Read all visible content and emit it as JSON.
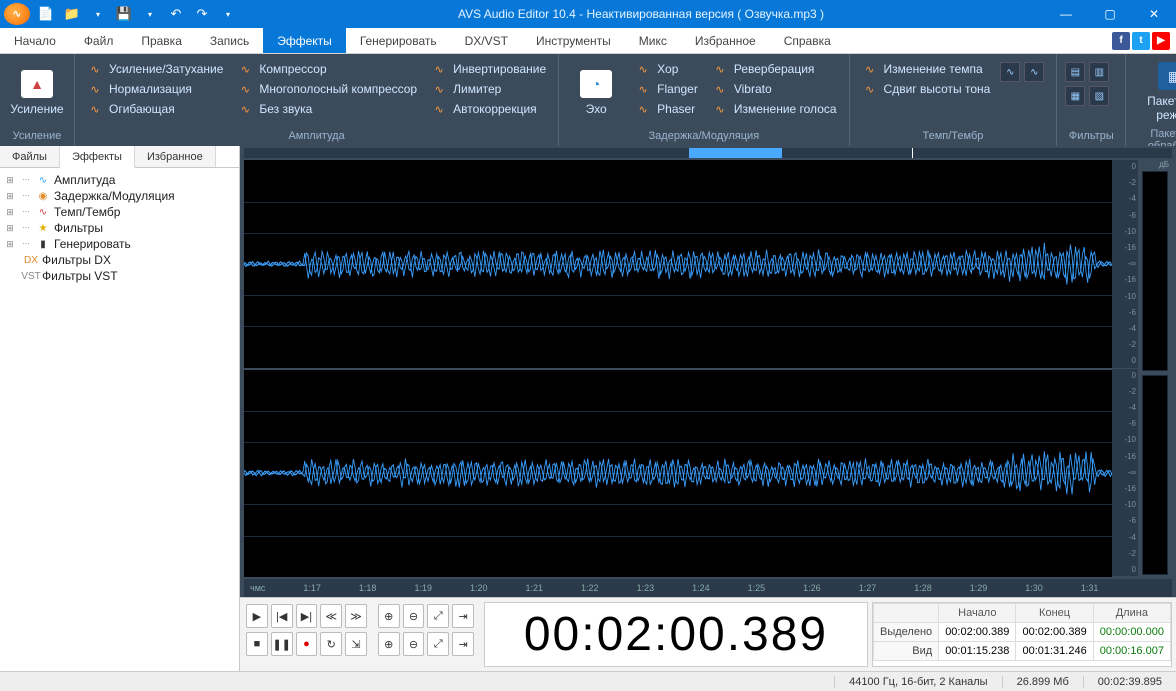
{
  "window": {
    "title": "AVS Audio Editor 10.4 - Неактивированная версия ( Озвучка.mp3 )"
  },
  "menus": [
    "Начало",
    "Файл",
    "Правка",
    "Запись",
    "Эффекты",
    "Генерировать",
    "DX/VST",
    "Инструменты",
    "Микс",
    "Избранное",
    "Справка"
  ],
  "active_menu_index": 4,
  "ribbon": {
    "g1": {
      "label": "Усиление",
      "big": "Усиление"
    },
    "g2": {
      "label": "Амплитуда",
      "col1": [
        "Усиление/Затухание",
        "Нормализация",
        "Огибающая"
      ],
      "col2": [
        "Компрессор",
        "Многополосный компрессор",
        "Без звука"
      ],
      "col3": [
        "Инвертирование",
        "Лимитер",
        "Автокоррекция"
      ]
    },
    "g3": {
      "label": "Задержка/Модуляция",
      "big": "Эхо",
      "col1": [
        "Хор",
        "Flanger",
        "Phaser"
      ],
      "col2": [
        "Реверберация",
        "Vibrato",
        "Изменение голоса"
      ]
    },
    "g4": {
      "label": "Темп/Тембр",
      "items": [
        "Изменение темпа",
        "Сдвиг высоты тона"
      ]
    },
    "g5": {
      "label": "Фильтры"
    },
    "g6": {
      "label": "Пакетная обработка",
      "big1": "Пакетный",
      "big2": "режим"
    }
  },
  "side_tabs": [
    "Файлы",
    "Эффекты",
    "Избранное"
  ],
  "active_side_tab": 1,
  "tree": [
    {
      "label": "Амплитуда",
      "expand": true,
      "icon": "∿",
      "color": "#2aa3ff"
    },
    {
      "label": "Задержка/Модуляция",
      "expand": true,
      "icon": "◉",
      "color": "#e08a2a"
    },
    {
      "label": "Темп/Тембр",
      "expand": true,
      "icon": "∿",
      "color": "#d04040"
    },
    {
      "label": "Фильтры",
      "expand": true,
      "icon": "★",
      "color": "#e0b000"
    },
    {
      "label": "Генерировать",
      "expand": true,
      "icon": "▮",
      "color": "#333"
    },
    {
      "label": "Фильтры DX",
      "expand": false,
      "icon": "DX",
      "color": "#e08a2a",
      "leaf": true
    },
    {
      "label": "Фильтры VST",
      "expand": false,
      "icon": "VST",
      "color": "#888",
      "leaf": true
    }
  ],
  "vscale": [
    "0",
    "-2",
    "-4",
    "-6",
    "-10",
    "-16",
    "-∞",
    "-16",
    "-10",
    "-6",
    "-4",
    "-2",
    "0"
  ],
  "db_label": "дБ",
  "timeline_unit": "чмс",
  "timeline": [
    "1:17",
    "1:18",
    "1:19",
    "1:20",
    "1:21",
    "1:22",
    "1:23",
    "1:24",
    "1:25",
    "1:26",
    "1:27",
    "1:28",
    "1:29",
    "1:30",
    "1:31"
  ],
  "bigtime": "00:02:00.389",
  "sel": {
    "h_start": "Начало",
    "h_end": "Конец",
    "h_len": "Длина",
    "r1": "Выделено",
    "r2": "Вид",
    "s_start": "00:02:00.389",
    "s_end": "00:02:00.389",
    "s_len": "00:00:00.000",
    "v_start": "00:01:15.238",
    "v_end": "00:01:31.246",
    "v_len": "00:00:16.007"
  },
  "status": {
    "format": "44100 Гц, 16-бит, 2 Каналы",
    "size": "26.899 Мб",
    "duration": "00:02:39.895"
  }
}
